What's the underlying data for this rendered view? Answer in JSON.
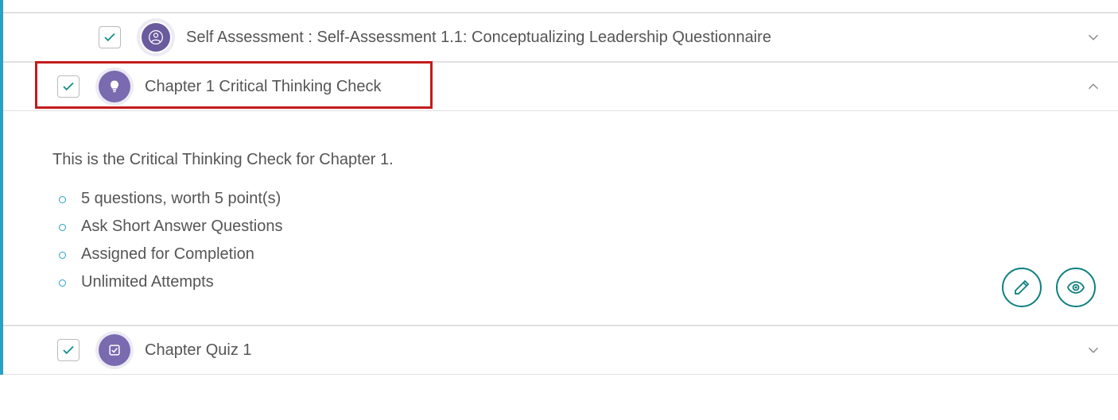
{
  "items": [
    {
      "title": "Self Assessment : Self-Assessment 1.1: Conceptualizing Leadership Questionnaire",
      "expanded": false
    },
    {
      "title": "Chapter 1 Critical Thinking Check",
      "expanded": true,
      "highlighted": true,
      "description": "This is the Critical Thinking Check for Chapter 1.",
      "details": [
        "5 questions, worth 5 point(s)",
        "Ask Short Answer Questions",
        "Assigned for Completion",
        "Unlimited Attempts"
      ]
    },
    {
      "title": "Chapter Quiz 1",
      "expanded": false
    }
  ]
}
